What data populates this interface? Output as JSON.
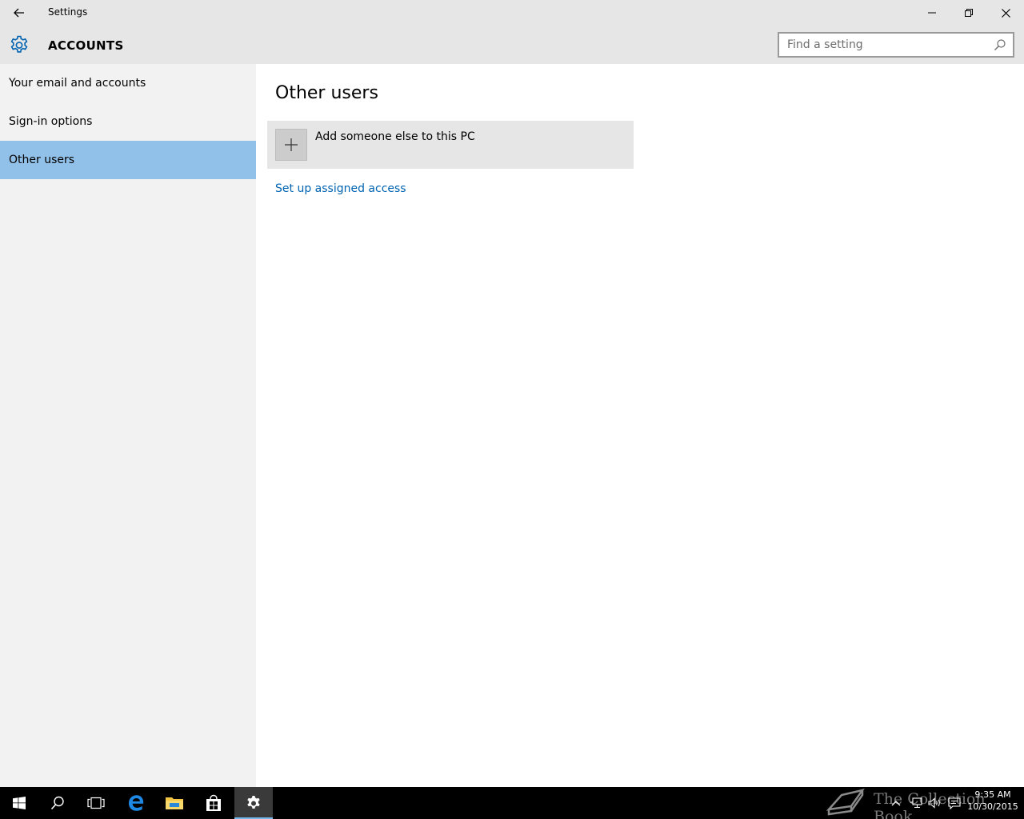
{
  "window": {
    "title": "Settings"
  },
  "header": {
    "section": "ACCOUNTS",
    "search_placeholder": "Find a setting"
  },
  "sidebar": {
    "items": [
      {
        "label": "Your email and accounts"
      },
      {
        "label": "Sign-in options"
      },
      {
        "label": "Other users",
        "selected": true
      }
    ]
  },
  "main": {
    "title": "Other users",
    "add_label": "Add someone else to this PC",
    "assigned_access_link": "Set up assigned access"
  },
  "taskbar": {
    "watermark": "The Collection Book",
    "time": "9:35 AM",
    "date": "10/30/2015"
  },
  "colors": {
    "accent": "#0063b1",
    "selected_nav": "#91c1e8",
    "chrome": "#e6e6e6",
    "sidebar": "#f2f2f2",
    "taskbar": "#000000"
  },
  "icons": {
    "back": "back-arrow-icon",
    "gear": "gear-icon",
    "search": "search-icon",
    "minimize": "minimize-icon",
    "maximize": "restore-icon",
    "close": "close-icon",
    "plus": "plus-icon",
    "start": "windows-start-icon",
    "taskbar_search": "search-icon",
    "task_view": "task-view-icon",
    "edge": "edge-browser-icon",
    "explorer": "file-explorer-icon",
    "store": "store-icon",
    "settings": "gear-icon"
  }
}
